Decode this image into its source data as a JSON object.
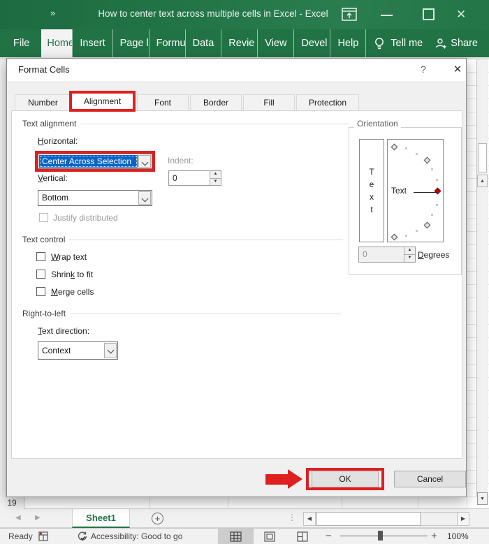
{
  "colors": {
    "excel_green": "#217346",
    "annotation_red": "#e02020",
    "selection_blue": "#0a64c8"
  },
  "window": {
    "collapse_glyph": "»",
    "title": "How to center text across multiple cells in Excel  -  Excel",
    "close_glyph": "✕"
  },
  "ribbon": {
    "tabs": [
      {
        "label": "File"
      },
      {
        "label": "Home"
      },
      {
        "label": "Insert"
      },
      {
        "label": "Page l"
      },
      {
        "label": "Formu"
      },
      {
        "label": "Data"
      },
      {
        "label": "Revie"
      },
      {
        "label": "View"
      },
      {
        "label": "Devel"
      },
      {
        "label": "Help"
      }
    ],
    "tell_me": "Tell me",
    "share": "Share"
  },
  "dialog": {
    "title": "Format Cells",
    "help_glyph": "?",
    "close_glyph": "✕",
    "tabs": [
      "Number",
      "Alignment",
      "Font",
      "Border",
      "Fill",
      "Protection"
    ],
    "text_alignment": {
      "title": "Text alignment",
      "horizontal_label": {
        "pre": "",
        "key": "H",
        "post": "orizontal:"
      },
      "horizontal_value": "Center Across Selection",
      "indent_label": "Indent:",
      "indent_value": "0",
      "vertical_label": {
        "pre": "",
        "key": "V",
        "post": "ertical:"
      },
      "vertical_value": "Bottom",
      "justify_label": "Justify distributed"
    },
    "orientation": {
      "title": "Orientation",
      "side_letters": [
        "T",
        "e",
        "x",
        "t"
      ],
      "sample_text": "Text",
      "degrees_value": "0",
      "degrees_label": {
        "pre": "",
        "key": "D",
        "post": "egrees"
      }
    },
    "text_control": {
      "title": "Text control",
      "wrap": {
        "pre": "",
        "key": "W",
        "post": "rap text"
      },
      "shrink": {
        "pre": "Shrin",
        "key": "k",
        "post": " to fit"
      },
      "merge": {
        "pre": "",
        "key": "M",
        "post": "erge cells"
      }
    },
    "rtl": {
      "title": "Right-to-left",
      "direction_label": {
        "pre": "",
        "key": "T",
        "post": "ext direction:"
      },
      "direction_value": "Context"
    },
    "ok_label": "OK",
    "cancel_label": "Cancel"
  },
  "grid": {
    "row_label": "19"
  },
  "sheetbar": {
    "tab_label": "Sheet1",
    "new_sheet_glyph": "+",
    "dots_glyph": "⋮"
  },
  "statusbar": {
    "ready": "Ready",
    "accessibility": "Accessibility: Good to go",
    "zoom_pct": "100%",
    "zoom_minus": "−",
    "zoom_plus": "+"
  },
  "icons": {
    "left": "◀",
    "right": "▶",
    "up": "▲",
    "down": "▼"
  }
}
